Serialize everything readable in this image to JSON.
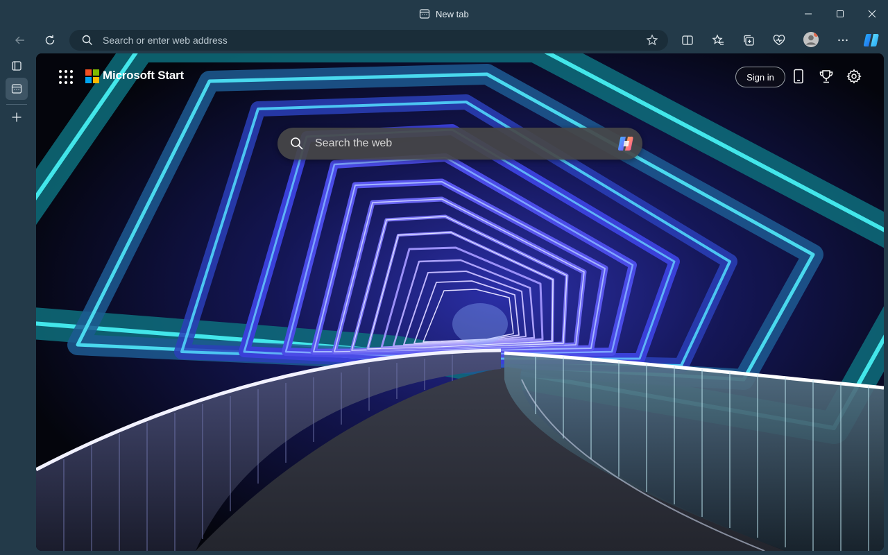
{
  "window": {
    "tab_title": "New tab",
    "controls": [
      "minimize",
      "maximize",
      "close"
    ]
  },
  "toolbar": {
    "address_placeholder": "Search or enter web address",
    "address_value": "",
    "buttons": [
      "back-icon",
      "refresh-icon",
      "favorite-star-icon",
      "split-screen-icon",
      "favorites-icon",
      "collections-icon",
      "browser-essentials-icon",
      "profile-avatar",
      "more-icon",
      "copilot-icon"
    ]
  },
  "vertical_tabs": {
    "items": [
      "tab-actions-icon",
      "new-tab-page-icon",
      "add-tab-icon"
    ]
  },
  "page": {
    "brand": "Microsoft Start",
    "sign_in_label": "Sign in",
    "search_placeholder": "Search the web",
    "header_icons": [
      "apps-grid-icon",
      "mobile-phone-icon",
      "rewards-trophy-icon",
      "settings-gear-icon"
    ],
    "background": "Illuminated neon footbridge tunnel at night",
    "colors": {
      "chrome": "#233a49",
      "address_bar": "#1a2d39",
      "ms_red": "#f25022",
      "ms_green": "#7fba00",
      "ms_blue": "#00a4ef",
      "ms_yellow": "#ffb900",
      "neon_cyan": "#3fe3e6",
      "neon_blue": "#5a5bf0"
    }
  }
}
